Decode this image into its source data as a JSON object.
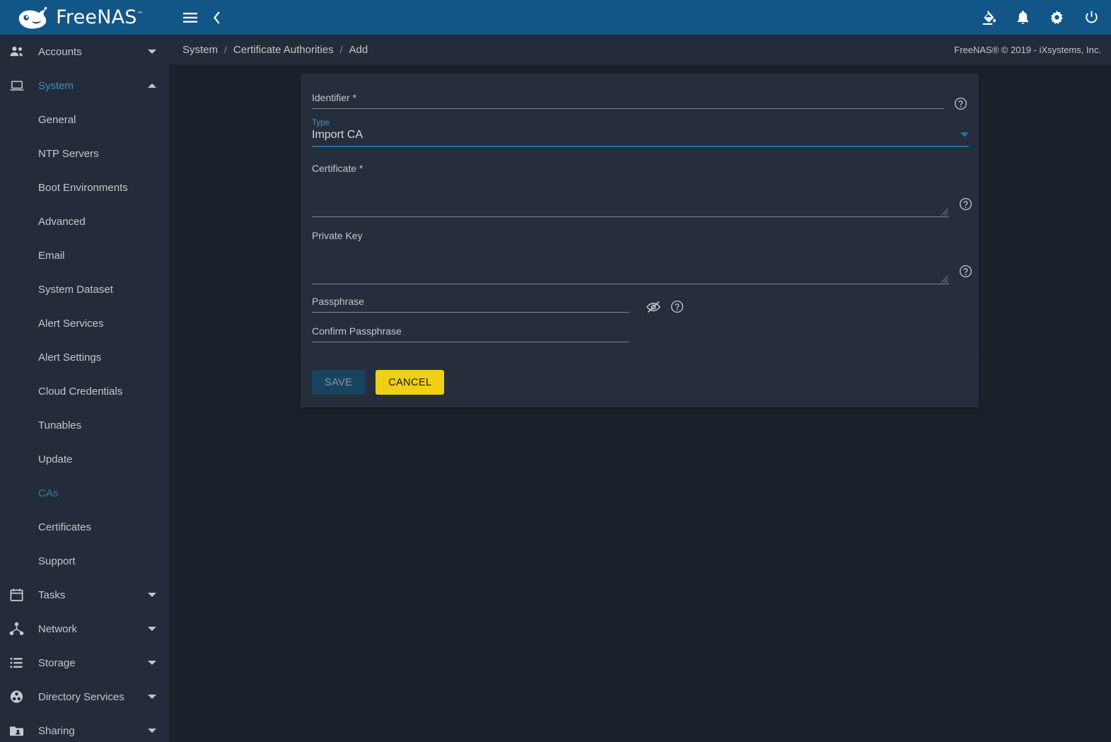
{
  "brand": {
    "name": "FreeNAS",
    "trademark": "™",
    "logo_icon": "freenas-fish-logo"
  },
  "topbar": {
    "menu_icon": "hamburger-menu-icon",
    "back_icon": "chevron-left-icon",
    "actions": [
      {
        "icon": "theme-paint-bucket-icon",
        "name": "theme-toggle-button"
      },
      {
        "icon": "bell-icon",
        "name": "notifications-button"
      },
      {
        "icon": "gear-icon",
        "name": "settings-button"
      },
      {
        "icon": "power-icon",
        "name": "power-button"
      }
    ]
  },
  "breadcrumb": {
    "items": [
      "System",
      "Certificate Authorities",
      "Add"
    ],
    "separator": "/",
    "copyright": "FreeNAS® © 2019 - iXsystems, Inc."
  },
  "sidebar": {
    "groups": [
      {
        "label": "Accounts",
        "icon": "people-icon",
        "active": false,
        "expanded": false
      },
      {
        "label": "System",
        "icon": "laptop-icon",
        "active": true,
        "expanded": true
      }
    ],
    "system_items": [
      {
        "label": "General",
        "active": false
      },
      {
        "label": "NTP Servers",
        "active": false
      },
      {
        "label": "Boot Environments",
        "active": false
      },
      {
        "label": "Advanced",
        "active": false
      },
      {
        "label": "Email",
        "active": false
      },
      {
        "label": "System Dataset",
        "active": false
      },
      {
        "label": "Alert Services",
        "active": false
      },
      {
        "label": "Alert Settings",
        "active": false
      },
      {
        "label": "Cloud Credentials",
        "active": false
      },
      {
        "label": "Tunables",
        "active": false
      },
      {
        "label": "Update",
        "active": false
      },
      {
        "label": "CAs",
        "active": true
      },
      {
        "label": "Certificates",
        "active": false
      },
      {
        "label": "Support",
        "active": false
      }
    ],
    "bottom_groups": [
      {
        "label": "Tasks",
        "icon": "calendar-icon",
        "expanded": false
      },
      {
        "label": "Network",
        "icon": "network-node-icon",
        "expanded": false
      },
      {
        "label": "Storage",
        "icon": "storage-list-icon",
        "expanded": false
      },
      {
        "label": "Directory Services",
        "icon": "directory-services-icon",
        "expanded": false
      },
      {
        "label": "Sharing",
        "icon": "sharing-folder-icon",
        "expanded": false
      }
    ]
  },
  "form": {
    "identifier": {
      "label": "Identifier *",
      "value": "",
      "placeholder": ""
    },
    "type": {
      "floating_label": "Type",
      "value": "Import CA",
      "arrow_icon": "chevron-down-icon"
    },
    "certificate": {
      "label": "Certificate *",
      "value": "",
      "placeholder": ""
    },
    "private_key": {
      "label": "Private Key",
      "value": "",
      "placeholder": ""
    },
    "passphrase": {
      "label": "Passphrase",
      "value": "",
      "visibility_icon": "eye-off-icon"
    },
    "confirm_passphrase": {
      "label": "Confirm Passphrase",
      "value": ""
    },
    "help_icon": "help-circle-icon",
    "buttons": {
      "save": "SAVE",
      "cancel": "CANCEL"
    }
  },
  "colors": {
    "header_blue": "#125687",
    "sidebar_bg": "#232c38",
    "page_bg": "#1a212a",
    "card_bg": "#252e3a",
    "accent_blue": "#1f6fa8",
    "active_link": "#2e7cab",
    "cancel_yellow": "#f0cf15",
    "save_bg": "#18445f"
  }
}
